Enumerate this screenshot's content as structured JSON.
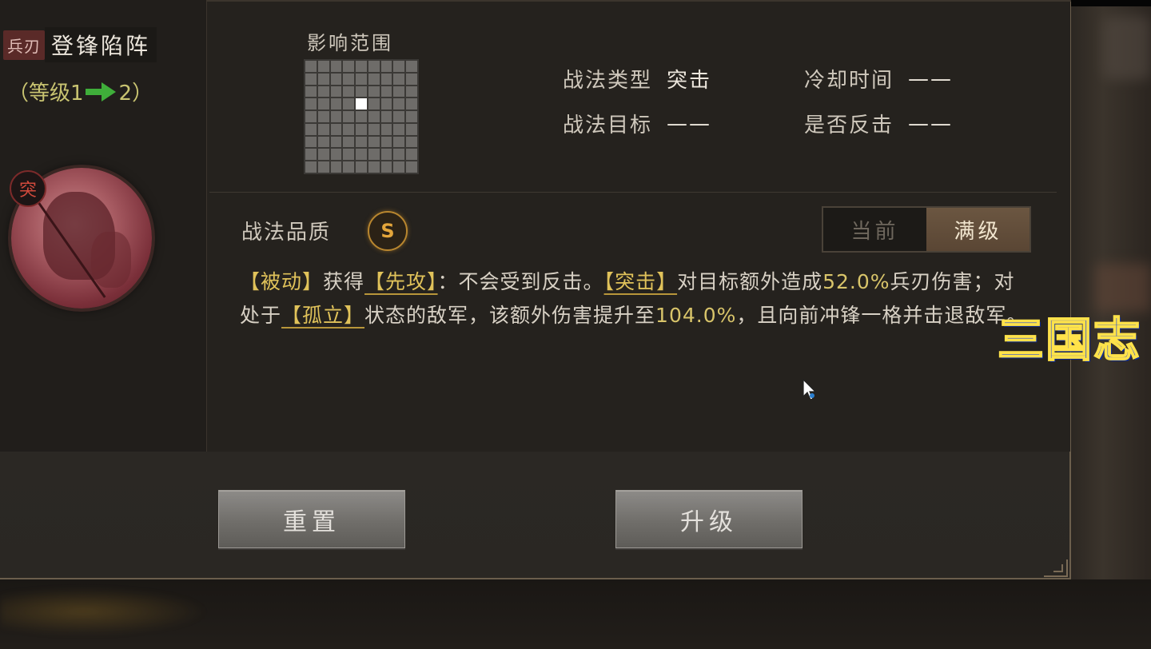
{
  "skill": {
    "category_tag": "兵刃",
    "name": "登锋陷阵",
    "level_open": "（等级1",
    "level_close": "2）",
    "type_badge": "突"
  },
  "range": {
    "label": "影响范围",
    "grid_size": 9,
    "active_cell": [
      3,
      4
    ]
  },
  "attributes": {
    "skill_type_label": "战法类型",
    "skill_type_value": "突击",
    "target_label": "战法目标",
    "target_value": "——",
    "cooldown_label": "冷却时间",
    "cooldown_value": "——",
    "counter_label": "是否反击",
    "counter_value": "——"
  },
  "quality": {
    "label": "战法品质",
    "grade": "S"
  },
  "toggle": {
    "current": "当前",
    "max": "满级",
    "selected": "max"
  },
  "description": {
    "p1": "【被动】",
    "p2": "获得",
    "p3": "【先攻】",
    "p4": "：不会受到反击。",
    "p5": "【突击】",
    "p6": "对目标额外造成",
    "p7": "52.0%",
    "p8": "兵刃伤害；对处于",
    "p9": "【孤立】",
    "p10": "状态的敌军，该额外伤害提升至",
    "p11": "104.0%",
    "p12": "，且向前冲锋一格并击退敌军。"
  },
  "buttons": {
    "reset": "重置",
    "upgrade": "升级"
  },
  "watermark": "三国志",
  "colors": {
    "keyword": "#e0c25a",
    "level_text": "#c9c471",
    "arrow": "#3fae3a",
    "quality": "#e4a63b",
    "type_badge": "#d24a3c",
    "watermark": "#1c46d8"
  }
}
